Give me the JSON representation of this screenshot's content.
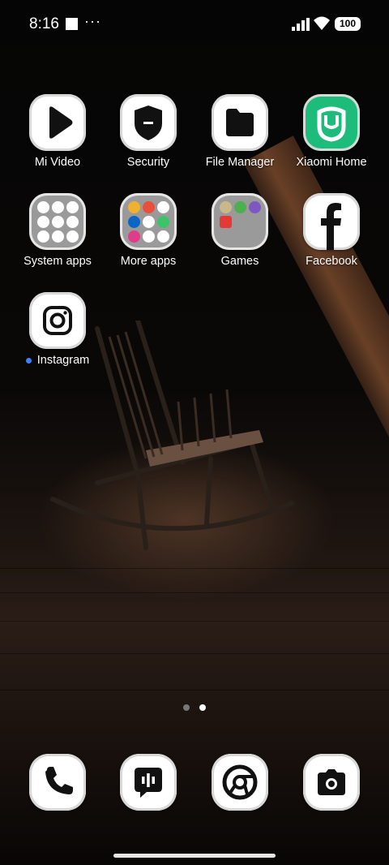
{
  "status_bar": {
    "time": "8:16",
    "more": "···",
    "battery": "100"
  },
  "apps": [
    {
      "label": "Mi Video",
      "icon": "play-icon"
    },
    {
      "label": "Security",
      "icon": "shield-icon"
    },
    {
      "label": "File Manager",
      "icon": "folder-icon"
    },
    {
      "label": "Xiaomi Home",
      "icon": "xiaomi-home-icon"
    },
    {
      "label": "System apps",
      "icon": "folder-icon"
    },
    {
      "label": "More apps",
      "icon": "folder-icon"
    },
    {
      "label": "Games",
      "icon": "folder-icon"
    },
    {
      "label": "Facebook",
      "icon": "facebook-icon"
    },
    {
      "label": "Instagram",
      "icon": "instagram-icon"
    }
  ],
  "dock": [
    {
      "icon": "phone-icon"
    },
    {
      "icon": "messages-icon"
    },
    {
      "icon": "chrome-icon"
    },
    {
      "icon": "camera-icon"
    }
  ],
  "pager": {
    "pages": 2,
    "current": 2
  },
  "colors": {
    "xiaomi_home_green": "#1ebc7a",
    "new_badge": "#3b82f6"
  }
}
